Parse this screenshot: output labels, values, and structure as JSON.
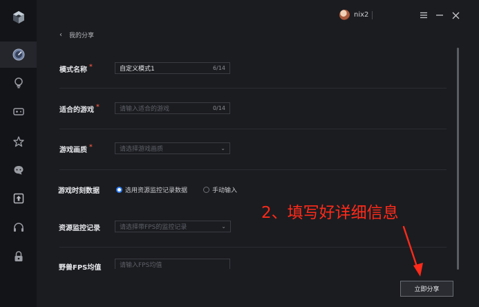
{
  "app": {
    "user": {
      "name": "nix2"
    }
  },
  "sidebar": {
    "items": [
      {
        "icon": "logo-cube-icon"
      },
      {
        "icon": "gauge-icon",
        "active": true
      },
      {
        "icon": "bulb-icon"
      },
      {
        "icon": "gamepad-icon"
      },
      {
        "icon": "star-icon"
      },
      {
        "icon": "chat-icon"
      },
      {
        "icon": "upload-icon"
      },
      {
        "icon": "headset-icon"
      },
      {
        "icon": "lock-icon"
      }
    ]
  },
  "breadcrumb": {
    "label": "我的分享"
  },
  "form": {
    "mode_name": {
      "label": "模式名称",
      "required_mark": "*",
      "value": "自定义模式1",
      "count": "6/14"
    },
    "game": {
      "label": "适合的游戏",
      "required_mark": "*",
      "placeholder": "请输入适合的游戏",
      "count": "0/14"
    },
    "quality": {
      "label": "游戏画质",
      "required_mark": "*",
      "placeholder": "请选择游戏画质"
    },
    "timing": {
      "label": "游戏时刻数据",
      "option_monitor": "选用资源监控记录数据",
      "option_manual": "手动输入",
      "selected": "option_monitor"
    },
    "monitor": {
      "label": "资源监控记录",
      "placeholder": "请选择带FPS的监控记录"
    },
    "fps": {
      "label": "野兽FPS均值",
      "placeholder": "请输入FPS均值"
    }
  },
  "annotation": {
    "text": "2、填写好详细信息"
  },
  "actions": {
    "share_label": "立即分享"
  },
  "colors": {
    "accent": "#2d7cf6",
    "annotation": "#ff2a1a",
    "required": "#e0533f"
  }
}
